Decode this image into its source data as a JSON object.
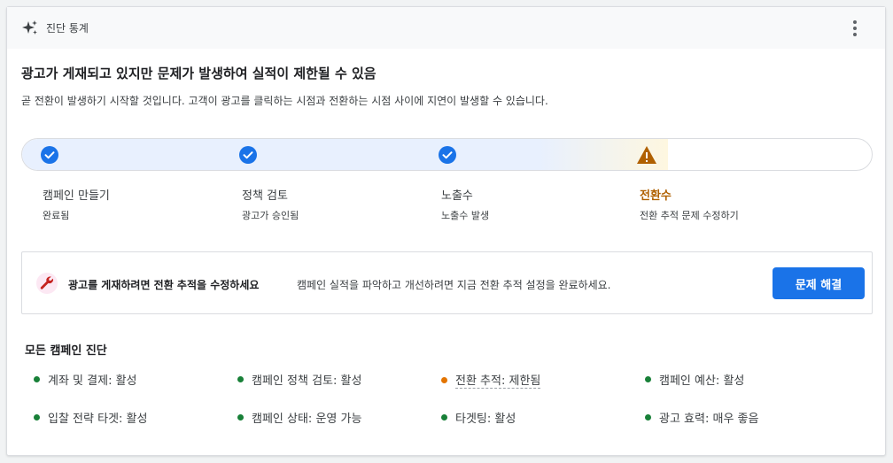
{
  "header": {
    "title": "진단 통계"
  },
  "headline": "광고가 게재되고 있지만 문제가 발생하여 실적이 제한될 수 있음",
  "subline": "곧 전환이 발생하기 시작할 것입니다. 고객이 광고를 클릭하는 시점과 전환하는 시점 사이에 지연이 발생할 수 있습니다.",
  "progress": {
    "completed_fraction": 0.76,
    "steps": [
      {
        "name": "캠페인 만들기",
        "status": "완료됨",
        "state": "done"
      },
      {
        "name": "정책 검토",
        "status": "광고가 승인됨",
        "state": "done"
      },
      {
        "name": "노출수",
        "status": "노출수 발생",
        "state": "done"
      },
      {
        "name": "전환수",
        "status": "전환 추적 문제 수정하기",
        "state": "warning"
      }
    ]
  },
  "alert": {
    "title": "광고를 게재하려면 전환 추적을 수정하세요",
    "body": "캠페인 실적을 파악하고 개선하려면 지금 전환 추적 설정을 완료하세요.",
    "button_label": "문제 해결"
  },
  "diagnostics": {
    "title": "모든 캠페인 진단",
    "items": [
      {
        "label": "계좌 및 결제: 활성",
        "status": "ok"
      },
      {
        "label": "캠페인 정책 검토: 활성",
        "status": "ok"
      },
      {
        "label": "전환 추적: 제한됨",
        "status": "warning"
      },
      {
        "label": "캠페인 예산: 활성",
        "status": "ok"
      },
      {
        "label": "입찰 전략 타겟: 활성",
        "status": "ok"
      },
      {
        "label": "캠페인 상태: 운영 가능",
        "status": "ok"
      },
      {
        "label": "타겟팅: 활성",
        "status": "ok"
      },
      {
        "label": "광고 효력: 매우 좋음",
        "status": "ok"
      }
    ]
  },
  "colors": {
    "ok": "#188038",
    "warning": "#e37400",
    "primary": "#1a73e8",
    "check": "#1a73e8",
    "warning_icon": "#b06000"
  },
  "icons": {
    "header": "sparkle-icon",
    "menu": "more-vert-icon",
    "done": "check-circle-icon",
    "warning": "warning-triangle-icon",
    "alert": "wrench-icon"
  }
}
